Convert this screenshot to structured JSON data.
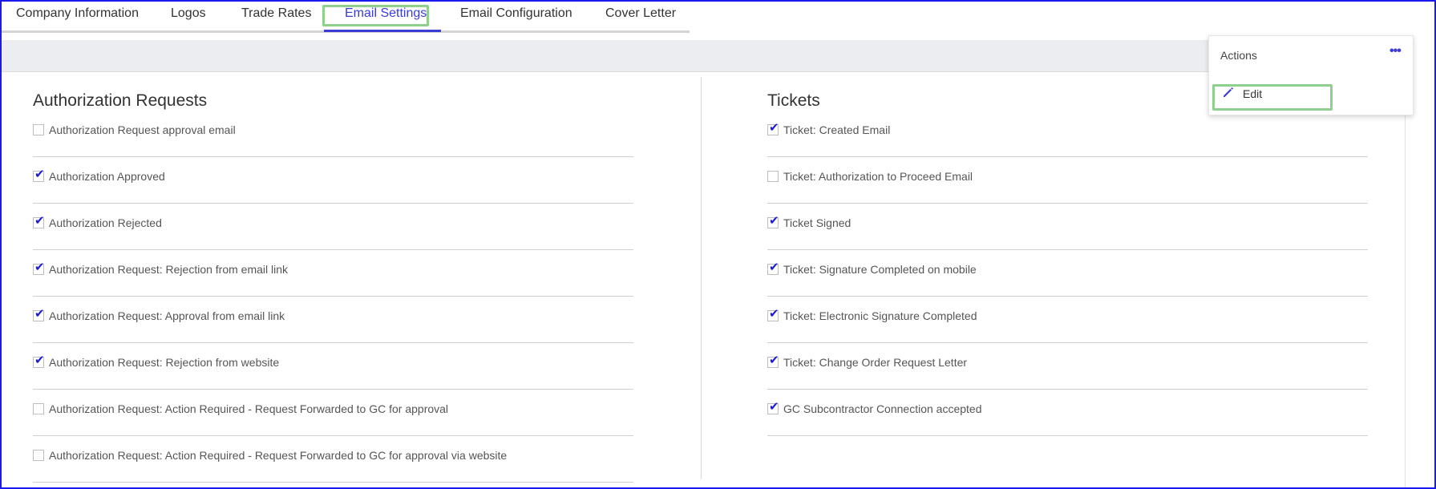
{
  "tabs": [
    {
      "label": "Company Information"
    },
    {
      "label": "Logos"
    },
    {
      "label": "Trade Rates"
    },
    {
      "label": "Email Settings",
      "active": true
    },
    {
      "label": "Email Configuration"
    },
    {
      "label": "Cover Letter"
    }
  ],
  "actions": {
    "title": "Actions",
    "menu_icon": "more-dots-icon",
    "edit_label": "Edit",
    "edit_icon": "pencil-icon"
  },
  "authorization": {
    "title": "Authorization Requests",
    "items": [
      {
        "label": "Authorization Request approval email",
        "checked": false
      },
      {
        "label": "Authorization Approved",
        "checked": true
      },
      {
        "label": "Authorization Rejected",
        "checked": true
      },
      {
        "label": "Authorization Request: Rejection from email link",
        "checked": true
      },
      {
        "label": "Authorization Request: Approval from email link",
        "checked": true
      },
      {
        "label": "Authorization Request: Rejection from website",
        "checked": true
      },
      {
        "label": "Authorization Request: Action Required - Request Forwarded to GC for approval",
        "checked": false
      },
      {
        "label": "Authorization Request: Action Required - Request Forwarded to GC for approval via website",
        "checked": false
      }
    ]
  },
  "tickets": {
    "title": "Tickets",
    "items": [
      {
        "label": "Ticket: Created Email",
        "checked": true
      },
      {
        "label": "Ticket: Authorization to Proceed Email",
        "checked": false
      },
      {
        "label": "Ticket Signed",
        "checked": true
      },
      {
        "label": "Ticket: Signature Completed on mobile",
        "checked": true
      },
      {
        "label": "Ticket: Electronic Signature Completed",
        "checked": true
      },
      {
        "label": "Ticket: Change Order Request Letter",
        "checked": true
      },
      {
        "label": "GC Subcontractor Connection accepted",
        "checked": true
      }
    ]
  },
  "colors": {
    "accent": "#3b3bd6",
    "highlight": "#8fd08f",
    "frame": "#1a1af0"
  }
}
